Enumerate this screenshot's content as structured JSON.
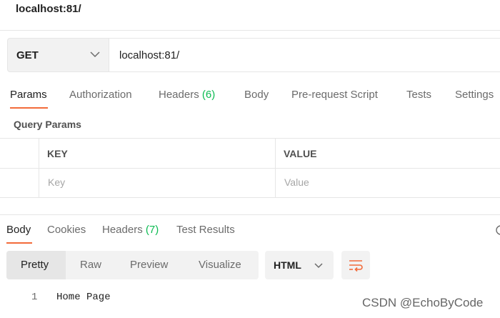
{
  "request": {
    "name": "localhost:81/",
    "method": "GET",
    "url": "localhost:81/"
  },
  "request_tabs": [
    {
      "label": "Params",
      "count": ""
    },
    {
      "label": "Authorization",
      "count": ""
    },
    {
      "label": "Headers",
      "count": "(6)"
    },
    {
      "label": "Body",
      "count": ""
    },
    {
      "label": "Pre-request Script",
      "count": ""
    },
    {
      "label": "Tests",
      "count": ""
    },
    {
      "label": "Settings",
      "count": ""
    }
  ],
  "params": {
    "title": "Query Params",
    "headers": {
      "key": "KEY",
      "value": "VALUE"
    },
    "row": {
      "key_placeholder": "Key",
      "value_placeholder": "Value"
    }
  },
  "response_tabs": [
    {
      "label": "Body",
      "count": ""
    },
    {
      "label": "Cookies",
      "count": ""
    },
    {
      "label": "Headers",
      "count": "(7)"
    },
    {
      "label": "Test Results",
      "count": ""
    }
  ],
  "view_modes": [
    "Pretty",
    "Raw",
    "Preview",
    "Visualize"
  ],
  "format": "HTML",
  "response_body": {
    "lines": [
      {
        "number": "1",
        "text": "Home Page"
      }
    ]
  },
  "watermark": "CSDN @EchoByCode",
  "colors": {
    "accent": "#f26b3a",
    "count": "#0cbb52"
  }
}
